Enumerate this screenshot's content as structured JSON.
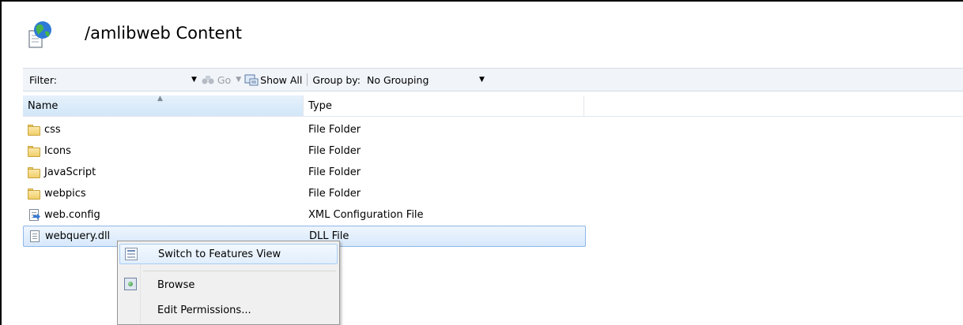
{
  "page": {
    "title": "/amlibweb Content"
  },
  "toolbar": {
    "filter_label": "Filter:",
    "filter_value": "",
    "go_label": "Go",
    "show_all_label": "Show All",
    "group_by_label": "Group by:",
    "group_by_value": "No Grouping"
  },
  "columns": {
    "name": "Name",
    "type": "Type"
  },
  "files": [
    {
      "name": "css",
      "type": "File Folder",
      "icon": "folder-icon"
    },
    {
      "name": "Icons",
      "type": "File Folder",
      "icon": "folder-icon"
    },
    {
      "name": "JavaScript",
      "type": "File Folder",
      "icon": "folder-icon"
    },
    {
      "name": "webpics",
      "type": "File Folder",
      "icon": "folder-icon"
    },
    {
      "name": "web.config",
      "type": "XML Configuration File",
      "icon": "config-file-icon"
    },
    {
      "name": "webquery.dll",
      "type": "DLL File",
      "icon": "dll-file-icon",
      "selected": true
    }
  ],
  "context_menu": {
    "switch_view": "Switch to Features View",
    "browse": "Browse",
    "edit_permissions": "Edit Permissions..."
  }
}
